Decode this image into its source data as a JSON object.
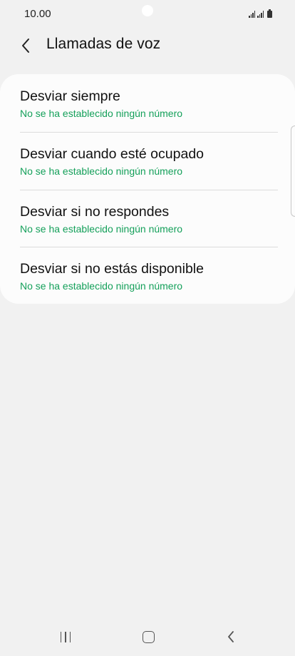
{
  "status_bar": {
    "time": "10.00",
    "icons": [
      "signal-icon",
      "signal-icon",
      "battery-icon"
    ]
  },
  "header": {
    "back_icon": "back-arrow-icon",
    "title": "Llamadas de voz"
  },
  "forwarding_options": [
    {
      "title": "Desviar siempre",
      "subtitle": "No se ha establecido ningún número"
    },
    {
      "title": "Desviar cuando esté ocupado",
      "subtitle": "No se ha establecido ningún número"
    },
    {
      "title": "Desviar si no respondes",
      "subtitle": "No se ha establecido ningún número"
    },
    {
      "title": "Desviar si no estás disponible",
      "subtitle": "No se ha establecido ningún número"
    }
  ],
  "navigation_bar": {
    "icons": [
      "recent-apps-icon",
      "home-icon",
      "back-icon"
    ]
  },
  "colors": {
    "background": "#f1f1f1",
    "card": "#fcfcfc",
    "accent_green": "#14a05a"
  }
}
